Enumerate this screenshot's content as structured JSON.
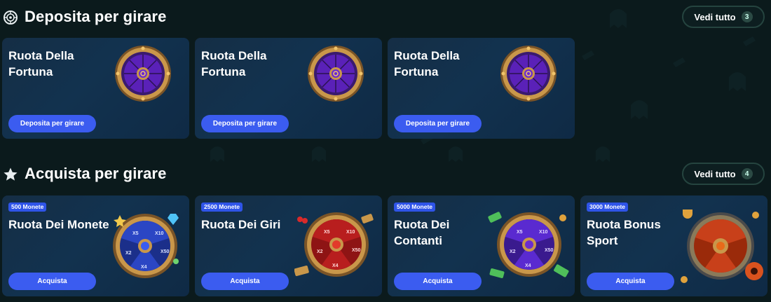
{
  "sections": [
    {
      "title": "Deposita per girare",
      "icon": "spin-wheel-icon",
      "see_all_label": "Vedi tutto",
      "see_all_count": "3",
      "cards": [
        {
          "title": "Ruota Della Fortuna",
          "button": "Deposita per girare",
          "wheel": "purple"
        },
        {
          "title": "Ruota Della Fortuna",
          "button": "Deposita per girare",
          "wheel": "purple"
        },
        {
          "title": "Ruota Della Fortuna",
          "button": "Deposita per girare",
          "wheel": "purple"
        }
      ]
    },
    {
      "title": "Acquista per girare",
      "icon": "star-icon",
      "see_all_label": "Vedi tutto",
      "see_all_count": "4",
      "cards": [
        {
          "tag": "500 Monete",
          "title": "Ruota Dei Monete",
          "button": "Acquista",
          "wheel": "blue"
        },
        {
          "tag": "2500 Monete",
          "title": "Ruota Dei Giri",
          "button": "Acquista",
          "wheel": "red"
        },
        {
          "tag": "5000 Monete",
          "title": "Ruota Dei Contanti",
          "button": "Acquista",
          "wheel": "violet"
        },
        {
          "tag": "3000 Monete",
          "title": "Ruota Bonus Sport",
          "button": "Acquista",
          "wheel": "orange"
        }
      ]
    }
  ],
  "colors": {
    "background": "#0b1a1c",
    "button": "#3b5cf0",
    "card": "#12324f",
    "gold": "#c9974a"
  }
}
